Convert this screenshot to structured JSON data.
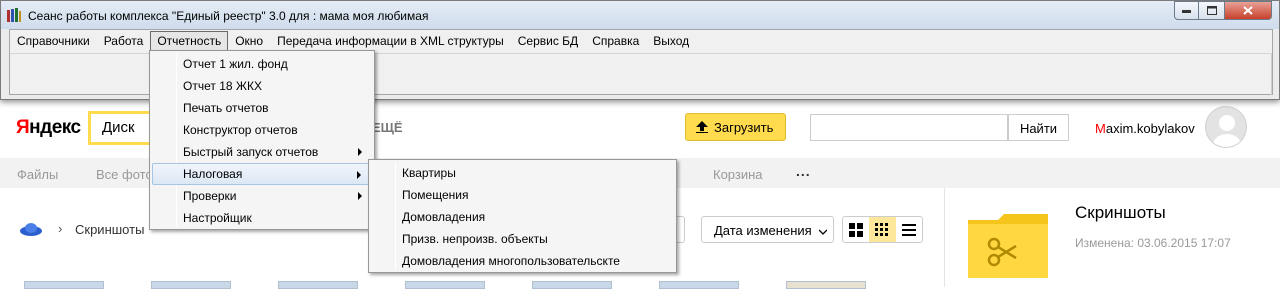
{
  "window": {
    "title": "Сеанс работы комплекса \"Единый реестр\" 3.0 для : мама моя любимая",
    "menubar": [
      {
        "label": "Справочники",
        "name": "menu-spravochniki"
      },
      {
        "label": "Работа",
        "name": "menu-rabota"
      },
      {
        "label": "Отчетность",
        "name": "menu-otchetnost",
        "open": true
      },
      {
        "label": "Окно",
        "name": "menu-okno"
      },
      {
        "label": "Передача информации в XML структуры",
        "name": "menu-xml"
      },
      {
        "label": "Сервис БД",
        "name": "menu-servis-bd"
      },
      {
        "label": "Справка",
        "name": "menu-spravka"
      },
      {
        "label": "Выход",
        "name": "menu-vyhod"
      }
    ]
  },
  "reports_menu": {
    "items": [
      {
        "label": "Отчет 1 жил. фонд",
        "submenu": false
      },
      {
        "label": "Отчет 18 ЖКХ",
        "submenu": false
      },
      {
        "label": "Печать отчетов",
        "submenu": false
      },
      {
        "label": "Конструктор отчетов",
        "submenu": false
      },
      {
        "label": "Быстрый запуск отчетов",
        "submenu": true
      },
      {
        "label": "Налоговая",
        "submenu": true,
        "highlighted": true
      },
      {
        "label": "Проверки",
        "submenu": true
      },
      {
        "label": "Настройщик",
        "submenu": false
      }
    ]
  },
  "tax_submenu": {
    "items": [
      {
        "label": "Квартиры"
      },
      {
        "label": "Помещения"
      },
      {
        "label": "Домовладения"
      },
      {
        "label": "Призв. непроизв. объекты"
      },
      {
        "label": "Домовладения многопользовательскте"
      }
    ]
  },
  "yandex_disk": {
    "logo": "Яндекс",
    "logo_first_letter": "Я",
    "logo_rest": "ндекс",
    "service": "Диск",
    "more_partial": "ЕЩЁ",
    "upload_label": "Загрузить",
    "search_button": "Найти",
    "search_value": "",
    "user_first_letter": "M",
    "user_rest": "axim.kobylakov",
    "tabs": [
      "Файлы",
      "Все фото",
      "Корзина"
    ],
    "tabs_more": "...",
    "breadcrumb": "Скриншоты",
    "sort_label": "Дата изменения",
    "folder_title": "Скриншоты",
    "folder_modified": "Изменена: 03.06.2015 17:07",
    "colors": {
      "accent": "#ffdb4d",
      "folder": "#ffd740"
    }
  }
}
